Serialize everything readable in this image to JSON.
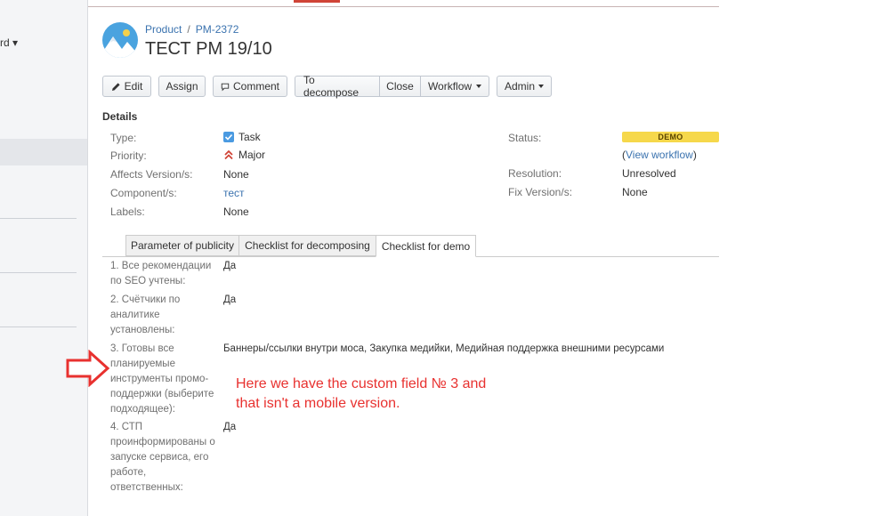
{
  "sidebar": {
    "fragment_label": "rd ▾"
  },
  "breadcrumb": {
    "project": "Product",
    "issue_key": "PM-2372",
    "separator": "/"
  },
  "issue": {
    "title": "ТЕСТ PM 19/10"
  },
  "toolbar": {
    "edit": "Edit",
    "assign": "Assign",
    "comment": "Comment",
    "to_decompose": "To decompose",
    "close": "Close",
    "workflow": "Workflow",
    "admin": "Admin"
  },
  "details": {
    "heading": "Details",
    "type_label": "Type:",
    "type_value": "Task",
    "priority_label": "Priority:",
    "priority_value": "Major",
    "affects_label": "Affects Version/s:",
    "affects_value": "None",
    "component_label": "Component/s:",
    "component_value": "тест",
    "labels_label": "Labels:",
    "labels_value": "None",
    "status_label": "Status:",
    "status_value": "DEMO",
    "view_workflow_open": "(",
    "view_workflow": "View workflow",
    "view_workflow_close": ")",
    "resolution_label": "Resolution:",
    "resolution_value": "Unresolved",
    "fix_label": "Fix Version/s:",
    "fix_value": "None"
  },
  "tabs": [
    {
      "label": "Parameter of publicity"
    },
    {
      "label": "Checklist for decomposing"
    },
    {
      "label": "Checklist for demo"
    }
  ],
  "checklist": [
    {
      "label": "1. Все рекомендации по SEO учтены:",
      "value": "Да"
    },
    {
      "label": "2. Счётчики по аналитике установлены:",
      "value": "Да"
    },
    {
      "label": "3. Готовы все планируемые инструменты промо-поддержки (выберите подходящее):",
      "value": "Баннеры/ссылки внутри моса, Закупка медийки, Медийная поддержка внешними ресурсами"
    },
    {
      "label": "4. СТП проинформированы о запуске сервиса, его работе, ответственных:",
      "value": "Да"
    }
  ],
  "annotation": {
    "text": "Here we have the custom field № 3 and that isn't a mobile version."
  },
  "colors": {
    "link": "#3b73af",
    "status_lozenge": "#f6d84b",
    "annotation": "#e8312f",
    "priority_major": "#d04437",
    "task_icon": "#4a9ae1"
  },
  "icons": {
    "edit": "pencil-icon",
    "comment": "speech-bubble-icon",
    "type": "task-checkbox-icon",
    "priority": "double-chevron-up-icon",
    "annotation": "right-arrow-outline-icon",
    "avatar": "mountain-landscape-icon"
  }
}
